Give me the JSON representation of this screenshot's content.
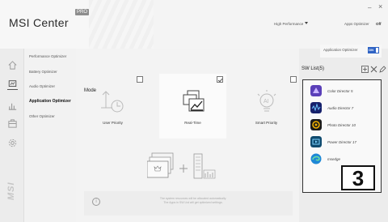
{
  "app": {
    "brand": "MSI Center",
    "pro_badge": "PRO"
  },
  "topbar": {
    "performance_mode": "High Performance",
    "apps_optimizer_label": "Apps Optimizer",
    "apps_optimizer_state": "Off",
    "minimize": "–",
    "close": "×"
  },
  "rail": {
    "icons": [
      "home-icon",
      "optimizer-icon",
      "chart-icon",
      "case-icon",
      "settings-gear-icon"
    ],
    "active_index": 1,
    "logo": "MSI"
  },
  "submenu": {
    "items": [
      {
        "label": "Performance Optimizer"
      },
      {
        "label": "Battery Optimizer"
      },
      {
        "label": "Audio Optimizer"
      },
      {
        "label": "Application Optimizer",
        "active": true
      },
      {
        "label": "Other Optimizer"
      }
    ]
  },
  "main": {
    "mode_title": "Mode",
    "cards": [
      {
        "label": "User Priority",
        "checked": false,
        "selected": false,
        "icon": "timer-arrow-icon"
      },
      {
        "label": "Real-Time",
        "checked": true,
        "selected": true,
        "icon": "realtime-chart-icon"
      },
      {
        "label": "Smart Priority",
        "checked": false,
        "selected": false,
        "icon": "ai-bulb-icon"
      }
    ],
    "info_text_line1": "The system resources will be allocated automatically.",
    "info_text_line2": "The Apps in SW List will get optimized settings."
  },
  "right_panel": {
    "app_optimizer_label": "Application Optimizer",
    "toggle_label": "ON",
    "toggle_on": true,
    "sw_list_title": "SW List(5)",
    "items": [
      {
        "name": "Color Director 5",
        "icon": "color-director-icon",
        "color": "#5a3fb8"
      },
      {
        "name": "Audio Director 7",
        "icon": "audio-director-icon",
        "color": "#16206b"
      },
      {
        "name": "Photo Director 10",
        "icon": "photo-director-icon",
        "color": "#1b1b1b"
      },
      {
        "name": "Power Director 17",
        "icon": "power-director-icon",
        "color": "#0f4a6e"
      },
      {
        "name": "msedge",
        "icon": "edge-icon",
        "color": "#1e88d6"
      }
    ],
    "badge": "3"
  },
  "colors": {
    "accent": "#2f63c4",
    "highlight_border": "#333333"
  }
}
